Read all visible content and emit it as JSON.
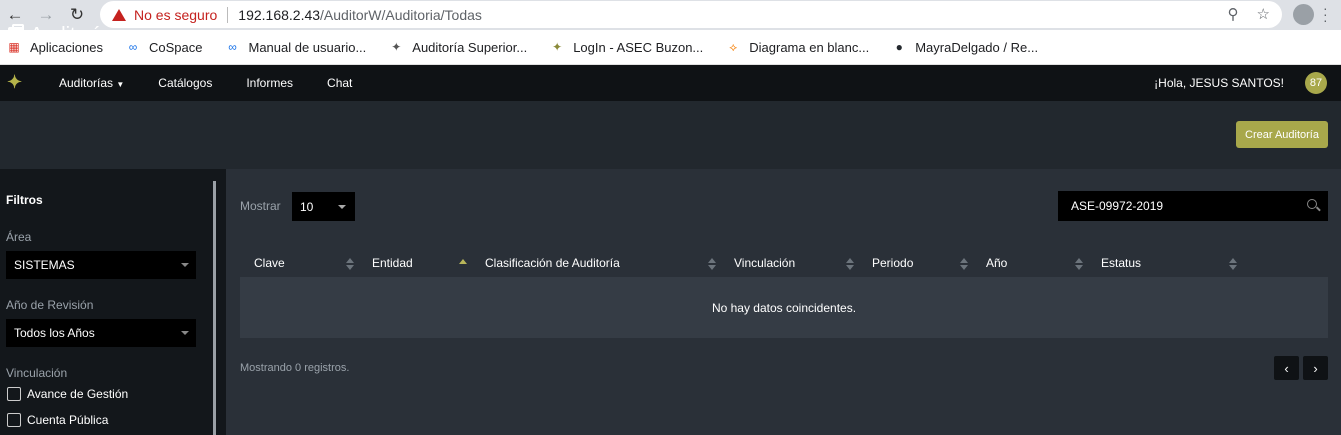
{
  "browser": {
    "insecure_label": "No es seguro",
    "url_host": "192.168.2.43",
    "url_path": "/AuditorW/Auditoria/Todas",
    "bookmarks": [
      {
        "label": "Aplicaciones",
        "icon": "apps-grid-icon"
      },
      {
        "label": "CoSpace",
        "icon": "cospace-icon"
      },
      {
        "label": "Manual de usuario...",
        "icon": "cospace-icon"
      },
      {
        "label": "Auditoría Superior...",
        "icon": "auditor-logo-icon"
      },
      {
        "label": "LogIn - ASEC Buzon...",
        "icon": "auditor-logo-icon"
      },
      {
        "label": "Diagrama en blanc...",
        "icon": "diagram-icon"
      },
      {
        "label": "MayraDelgado / Re...",
        "icon": "github-icon"
      }
    ]
  },
  "app": {
    "nav": [
      "Auditorías",
      "Catálogos",
      "Informes",
      "Chat"
    ],
    "greeting": "¡Hola, JESUS SANTOS!",
    "user_badge": "87",
    "accent": "#a8a84b"
  },
  "page": {
    "title": "Auditorías",
    "create_button": "Crear Auditoría"
  },
  "filters": {
    "title": "Filtros",
    "area_label": "Área",
    "area_value": "SISTEMAS",
    "year_label": "Año de Revisión",
    "year_value": "Todos los Años",
    "vinc_label": "Vinculación",
    "checkboxes": [
      "Avance de Gestión",
      "Cuenta Pública"
    ]
  },
  "table": {
    "show_label": "Mostrar",
    "show_value": "10",
    "search_value": "ASE-09972-2019",
    "columns": [
      "Clave",
      "Entidad",
      "Clasificación de Auditoría",
      "Vinculación",
      "Periodo",
      "Año",
      "Estatus"
    ],
    "empty_message": "No hay datos coincidentes.",
    "records_text": "Mostrando 0 registros.",
    "prev": "‹",
    "next": "›"
  }
}
